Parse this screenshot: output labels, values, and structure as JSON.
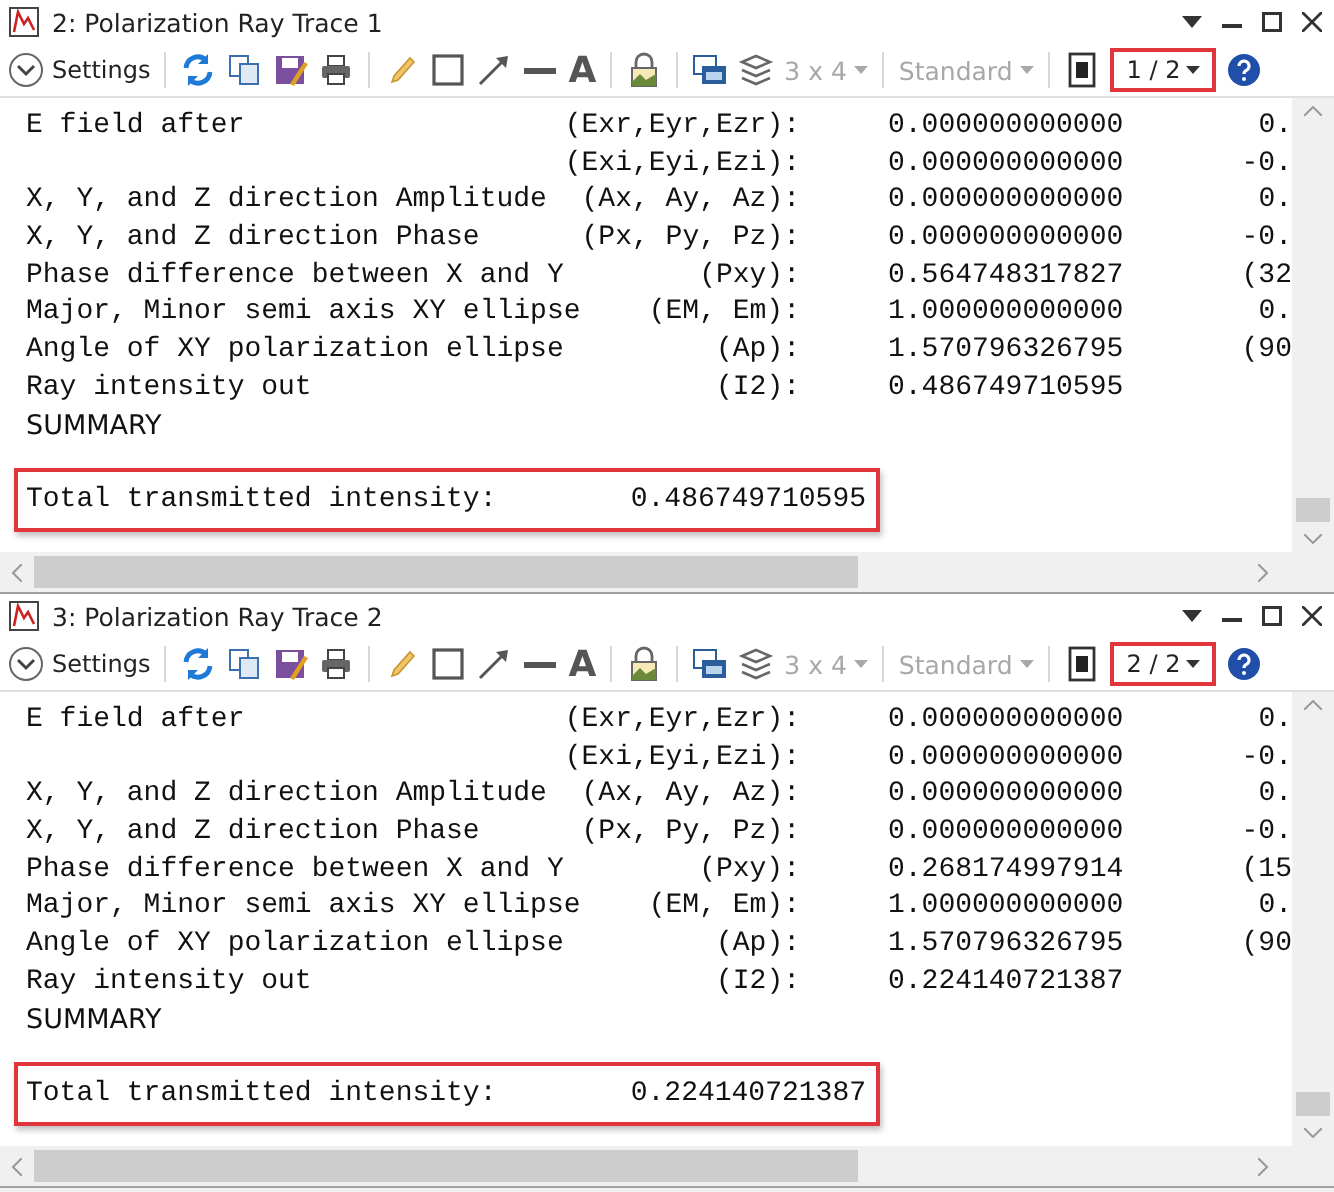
{
  "panels": [
    {
      "title": "2: Polarization Ray Trace 1",
      "toolbar": {
        "settings": "Settings",
        "text_tool": "A",
        "grid": {
          "label": "3 x 4",
          "disabled": true
        },
        "style": {
          "label": "Standard",
          "disabled": true
        },
        "page": "1 / 2"
      },
      "rows": [
        {
          "label": "E field after",
          "symbol": "(Exr,Eyr,Ezr):",
          "value": "0.000000000000",
          "extra": "0."
        },
        {
          "label": "",
          "symbol": "(Exi,Eyi,Ezi):",
          "value": "0.000000000000",
          "extra": "-0."
        },
        {
          "label": "X, Y, and Z direction Amplitude",
          "symbol": "(Ax, Ay, Az):",
          "value": "0.000000000000",
          "extra": "0."
        },
        {
          "label": "X, Y, and Z direction Phase",
          "symbol": "(Px, Py, Pz):",
          "value": "0.000000000000",
          "extra": "-0."
        },
        {
          "label": "Phase difference between X and Y",
          "symbol": "(Pxy):",
          "value": "0.564748317827",
          "extra": "(32"
        },
        {
          "label": "Major, Minor semi axis XY ellipse",
          "symbol": "(EM, Em):",
          "value": "1.000000000000",
          "extra": "0."
        },
        {
          "label": "Angle of XY polarization ellipse",
          "symbol": "(Ap):",
          "value": "1.570796326795",
          "extra": "(90"
        },
        {
          "label": "Ray intensity out",
          "symbol": "(I2):",
          "value": "0.486749710595",
          "extra": ""
        }
      ],
      "summary": "SUMMARY",
      "total": {
        "label": "Total transmitted intensity:",
        "value": "0.486749710595"
      }
    },
    {
      "title": "3: Polarization Ray Trace 2",
      "toolbar": {
        "settings": "Settings",
        "text_tool": "A",
        "grid": {
          "label": "3 x 4",
          "disabled": true
        },
        "style": {
          "label": "Standard",
          "disabled": true
        },
        "page": "2 / 2"
      },
      "rows": [
        {
          "label": "E field after",
          "symbol": "(Exr,Eyr,Ezr):",
          "value": "0.000000000000",
          "extra": "0."
        },
        {
          "label": "",
          "symbol": "(Exi,Eyi,Ezi):",
          "value": "0.000000000000",
          "extra": "-0."
        },
        {
          "label": "X, Y, and Z direction Amplitude",
          "symbol": "(Ax, Ay, Az):",
          "value": "0.000000000000",
          "extra": "0."
        },
        {
          "label": "X, Y, and Z direction Phase",
          "symbol": "(Px, Py, Pz):",
          "value": "0.000000000000",
          "extra": "-0."
        },
        {
          "label": "Phase difference between X and Y",
          "symbol": "(Pxy):",
          "value": "0.268174997914",
          "extra": "(15"
        },
        {
          "label": "Major, Minor semi axis XY ellipse",
          "symbol": "(EM, Em):",
          "value": "1.000000000000",
          "extra": "0."
        },
        {
          "label": "Angle of XY polarization ellipse",
          "symbol": "(Ap):",
          "value": "1.570796326795",
          "extra": "(90"
        },
        {
          "label": "Ray intensity out",
          "symbol": "(I2):",
          "value": "0.224140721387",
          "extra": ""
        }
      ],
      "summary": "SUMMARY",
      "total": {
        "label": "Total transmitted intensity:",
        "value": "0.224140721387"
      }
    }
  ]
}
